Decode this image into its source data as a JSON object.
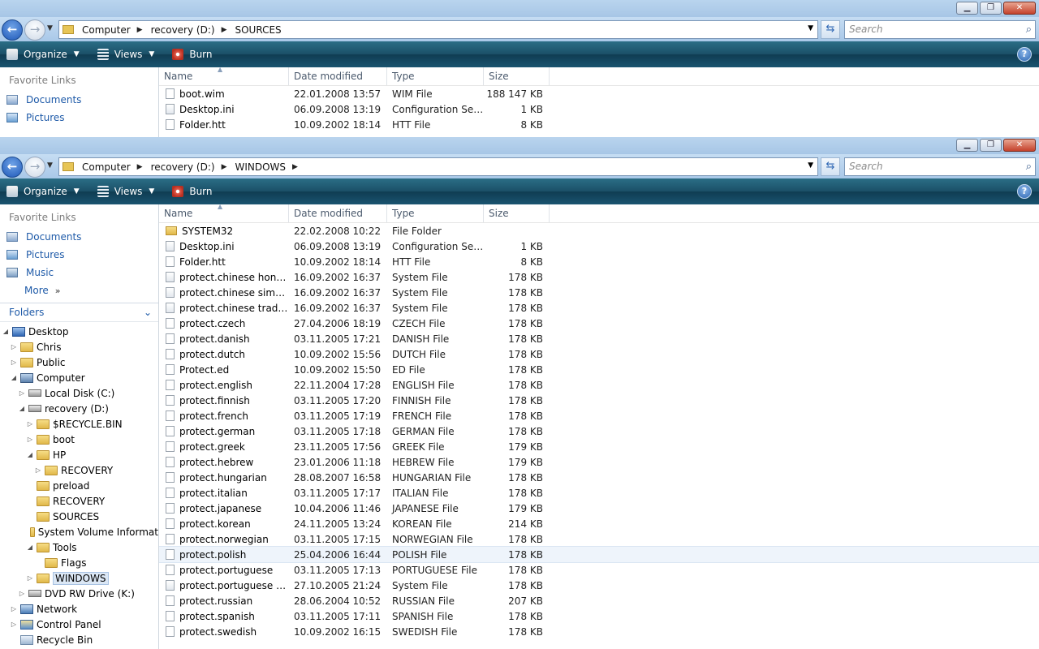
{
  "window1": {
    "breadcrumb": [
      "Computer",
      "recovery (D:)",
      "SOURCES"
    ],
    "search_placeholder": "Search",
    "toolbar": {
      "organize": "Organize",
      "views": "Views",
      "burn": "Burn"
    },
    "fav_title": "Favorite Links",
    "favorites": [
      "Documents",
      "Pictures"
    ],
    "columns": {
      "name": "Name",
      "date": "Date modified",
      "type": "Type",
      "size": "Size"
    },
    "files": [
      {
        "name": "boot.wim",
        "date": "22.01.2008 13:57",
        "type": "WIM File",
        "size": "188 147 KB"
      },
      {
        "name": "Desktop.ini",
        "date": "06.09.2008 13:19",
        "type": "Configuration Sett...",
        "size": "1 KB"
      },
      {
        "name": "Folder.htt",
        "date": "10.09.2002 18:14",
        "type": "HTT File",
        "size": "8 KB"
      }
    ]
  },
  "window2": {
    "breadcrumb": [
      "Computer",
      "recovery (D:)",
      "WINDOWS"
    ],
    "search_placeholder": "Search",
    "toolbar": {
      "organize": "Organize",
      "views": "Views",
      "burn": "Burn"
    },
    "fav_title": "Favorite Links",
    "favorites": [
      "Documents",
      "Pictures",
      "Music"
    ],
    "more": "More",
    "folders_label": "Folders",
    "tree": [
      {
        "label": "Desktop"
      },
      {
        "label": "Chris"
      },
      {
        "label": "Public"
      },
      {
        "label": "Computer"
      },
      {
        "label": "Local Disk (C:)"
      },
      {
        "label": "recovery (D:)"
      },
      {
        "label": "$RECYCLE.BIN"
      },
      {
        "label": "boot"
      },
      {
        "label": "HP"
      },
      {
        "label": "RECOVERY"
      },
      {
        "label": "preload"
      },
      {
        "label": "RECOVERY"
      },
      {
        "label": "SOURCES"
      },
      {
        "label": "System Volume Informat"
      },
      {
        "label": "Tools"
      },
      {
        "label": "Flags"
      },
      {
        "label": "WINDOWS"
      },
      {
        "label": "DVD RW Drive (K:)"
      },
      {
        "label": "Network"
      },
      {
        "label": "Control Panel"
      },
      {
        "label": "Recycle Bin"
      }
    ],
    "columns": {
      "name": "Name",
      "date": "Date modified",
      "type": "Type",
      "size": "Size"
    },
    "files": [
      {
        "name": "SYSTEM32",
        "date": "22.02.2008 10:22",
        "type": "File Folder",
        "size": ""
      },
      {
        "name": "Desktop.ini",
        "date": "06.09.2008 13:19",
        "type": "Configuration Sett...",
        "size": "1 KB"
      },
      {
        "name": "Folder.htt",
        "date": "10.09.2002 18:14",
        "type": "HTT File",
        "size": "8 KB"
      },
      {
        "name": "protect.chinese hong k...",
        "date": "16.09.2002 16:37",
        "type": "System File",
        "size": "178 KB"
      },
      {
        "name": "protect.chinese simplif...",
        "date": "16.09.2002 16:37",
        "type": "System File",
        "size": "178 KB"
      },
      {
        "name": "protect.chinese traditi...",
        "date": "16.09.2002 16:37",
        "type": "System File",
        "size": "178 KB"
      },
      {
        "name": "protect.czech",
        "date": "27.04.2006 18:19",
        "type": "CZECH File",
        "size": "178 KB"
      },
      {
        "name": "protect.danish",
        "date": "03.11.2005 17:21",
        "type": "DANISH File",
        "size": "178 KB"
      },
      {
        "name": "protect.dutch",
        "date": "10.09.2002 15:56",
        "type": "DUTCH File",
        "size": "178 KB"
      },
      {
        "name": "Protect.ed",
        "date": "10.09.2002 15:50",
        "type": "ED File",
        "size": "178 KB"
      },
      {
        "name": "protect.english",
        "date": "22.11.2004 17:28",
        "type": "ENGLISH File",
        "size": "178 KB"
      },
      {
        "name": "protect.finnish",
        "date": "03.11.2005 17:20",
        "type": "FINNISH File",
        "size": "178 KB"
      },
      {
        "name": "protect.french",
        "date": "03.11.2005 17:19",
        "type": "FRENCH File",
        "size": "178 KB"
      },
      {
        "name": "protect.german",
        "date": "03.11.2005 17:18",
        "type": "GERMAN File",
        "size": "178 KB"
      },
      {
        "name": "protect.greek",
        "date": "23.11.2005 17:56",
        "type": "GREEK File",
        "size": "179 KB"
      },
      {
        "name": "protect.hebrew",
        "date": "23.01.2006 11:18",
        "type": "HEBREW File",
        "size": "179 KB"
      },
      {
        "name": "protect.hungarian",
        "date": "28.08.2007 16:58",
        "type": "HUNGARIAN File",
        "size": "178 KB"
      },
      {
        "name": "protect.italian",
        "date": "03.11.2005 17:17",
        "type": "ITALIAN File",
        "size": "178 KB"
      },
      {
        "name": "protect.japanese",
        "date": "10.04.2006 11:46",
        "type": "JAPANESE File",
        "size": "179 KB"
      },
      {
        "name": "protect.korean",
        "date": "24.11.2005 13:24",
        "type": "KOREAN File",
        "size": "214 KB"
      },
      {
        "name": "protect.norwegian",
        "date": "03.11.2005 17:15",
        "type": "NORWEGIAN File",
        "size": "178 KB"
      },
      {
        "name": "protect.polish",
        "date": "25.04.2006 16:44",
        "type": "POLISH File",
        "size": "178 KB"
      },
      {
        "name": "protect.portuguese",
        "date": "03.11.2005 17:13",
        "type": "PORTUGUESE File",
        "size": "178 KB"
      },
      {
        "name": "protect.portuguese bra...",
        "date": "27.10.2005 21:24",
        "type": "System File",
        "size": "178 KB"
      },
      {
        "name": "protect.russian",
        "date": "28.06.2004 10:52",
        "type": "RUSSIAN File",
        "size": "207 KB"
      },
      {
        "name": "protect.spanish",
        "date": "03.11.2005 17:11",
        "type": "SPANISH File",
        "size": "178 KB"
      },
      {
        "name": "protect.swedish",
        "date": "10.09.2002 16:15",
        "type": "SWEDISH File",
        "size": "178 KB"
      }
    ]
  }
}
